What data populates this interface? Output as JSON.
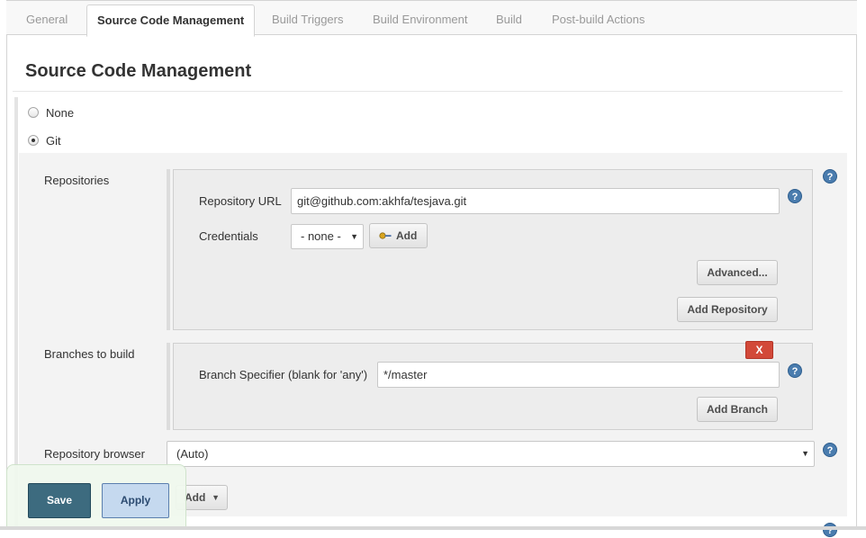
{
  "tabs": [
    {
      "label": "General",
      "active": false
    },
    {
      "label": "Source Code Management",
      "active": true
    },
    {
      "label": "Build Triggers",
      "active": false
    },
    {
      "label": "Build Environment",
      "active": false
    },
    {
      "label": "Build",
      "active": false
    },
    {
      "label": "Post-build Actions",
      "active": false
    }
  ],
  "section": {
    "title": "Source Code Management"
  },
  "scm_options": [
    {
      "label": "None",
      "checked": false
    },
    {
      "label": "Git",
      "checked": true
    }
  ],
  "git": {
    "repositories_label": "Repositories",
    "repository_url_label": "Repository URL",
    "repository_url_value": "git@github.com:akhfa/tesjava.git",
    "credentials_label": "Credentials",
    "credentials_selected": "- none -",
    "credentials_add_label": "Add",
    "advanced_label": "Advanced...",
    "add_repository_label": "Add Repository",
    "branches_label": "Branches to build",
    "delete_label": "X",
    "branch_specifier_label": "Branch Specifier (blank for 'any')",
    "branch_specifier_value": "*/master",
    "add_branch_label": "Add Branch",
    "repo_browser_label": "Repository browser",
    "repo_browser_selected": "(Auto)",
    "additional_add_label": "Add",
    "help_glyph": "?"
  },
  "footer": {
    "save_label": "Save",
    "apply_label": "Apply"
  },
  "colors": {
    "save": "#3d6b7f",
    "apply": "#c5d9ef",
    "delete": "#d24939",
    "help": "#4a7cae"
  }
}
